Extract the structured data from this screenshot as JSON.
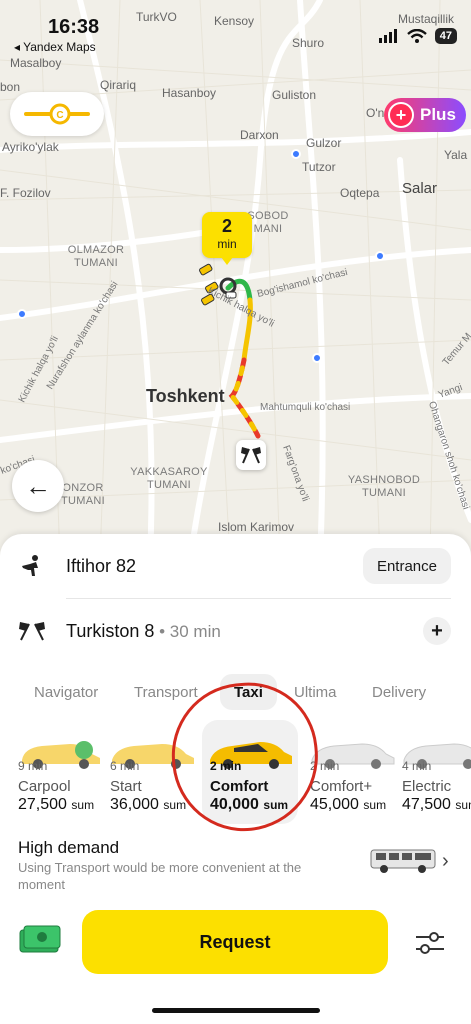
{
  "status_bar": {
    "time": "16:38",
    "back_app": "◂ Yandex Maps",
    "battery": "47"
  },
  "map": {
    "labels": {
      "turkvo": "TurkVO",
      "kensoy": "Kensoy",
      "mustaqillik": "Mustaqillik",
      "masalboy": "Masalboy",
      "qirariq": "Qirariq",
      "bon": "bon",
      "hasanboy": "Hasanboy",
      "guliston": "Guliston",
      "shuro": "Shuro",
      "on": "O'n",
      "yala": "Yala",
      "ayrikoylak": "Ayriko'ylak",
      "darxon": "Darxon",
      "gulzor": "Gulzor",
      "tutzor": "Tutzor",
      "oqtepa": "Oqtepa",
      "salar": "Salar",
      "fozilov": "F. Fozilov",
      "olmazor": "OLMAZOR TUMANI",
      "sobod": "SOBOD MANI",
      "yakkasaroy": "YAKKASAROY TUMANI",
      "yashnobod": "YASHNOBOD TUMANI",
      "onzor": "ONZOR TUMANI",
      "toshkent": "Toshkent",
      "islom": "Islom Karimov",
      "bogishamol": "Bog'ishamol ko'chasi",
      "kichikhalqa": "Kichik halqa yo'li",
      "nurafshon": "Nurafshon aylanma ko'chasi",
      "kichikhalqa2": "Kichik halqa yo'li",
      "mahtumquli": "Mahtumquli ko'chasi",
      "farg_ona": "Farg'ona yo'li",
      "ohangaron": "Ohangaron shoh ko'chasi",
      "temur": "Temur M",
      "yangi": "Yangi",
      "koch": "ko'chasi",
      "kochasi_right": "chasi"
    },
    "plus_label": "Plus",
    "eta_value": "2",
    "eta_unit": "min",
    "route_colors": {
      "green": "#2fb74a",
      "yellow": "#f5c400",
      "red": "#e83a2a"
    }
  },
  "sheet": {
    "pickup": {
      "address": "Iftihor 82",
      "entrance_label": "Entrance"
    },
    "destination": {
      "address": "Turkiston 8",
      "duration": " • 30 min"
    },
    "tabs": [
      {
        "label": "Navigator"
      },
      {
        "label": "Transport"
      },
      {
        "label": "Taxi"
      },
      {
        "label": "Ultima"
      },
      {
        "label": "Delivery"
      }
    ],
    "tariffs": [
      {
        "eta": "9 min",
        "name": "Carpool",
        "price": "27,500",
        "currency": "sum"
      },
      {
        "eta": "6 min",
        "name": "Start",
        "price": "36,000",
        "currency": "sum"
      },
      {
        "eta": "2 min",
        "name": "Comfort",
        "price": "40,000",
        "currency": "sum"
      },
      {
        "eta": "2 min",
        "name": "Comfort+",
        "price": "45,000",
        "currency": "sum"
      },
      {
        "eta": "4 min",
        "name": "Electric",
        "price": "47,500",
        "currency": "sum"
      }
    ],
    "high_demand": {
      "title": "High demand",
      "description": "Using Transport would be more convenient at the moment"
    },
    "request_label": "Request",
    "colors": {
      "accent": "#fce000",
      "annotation": "#d42a1e"
    }
  }
}
